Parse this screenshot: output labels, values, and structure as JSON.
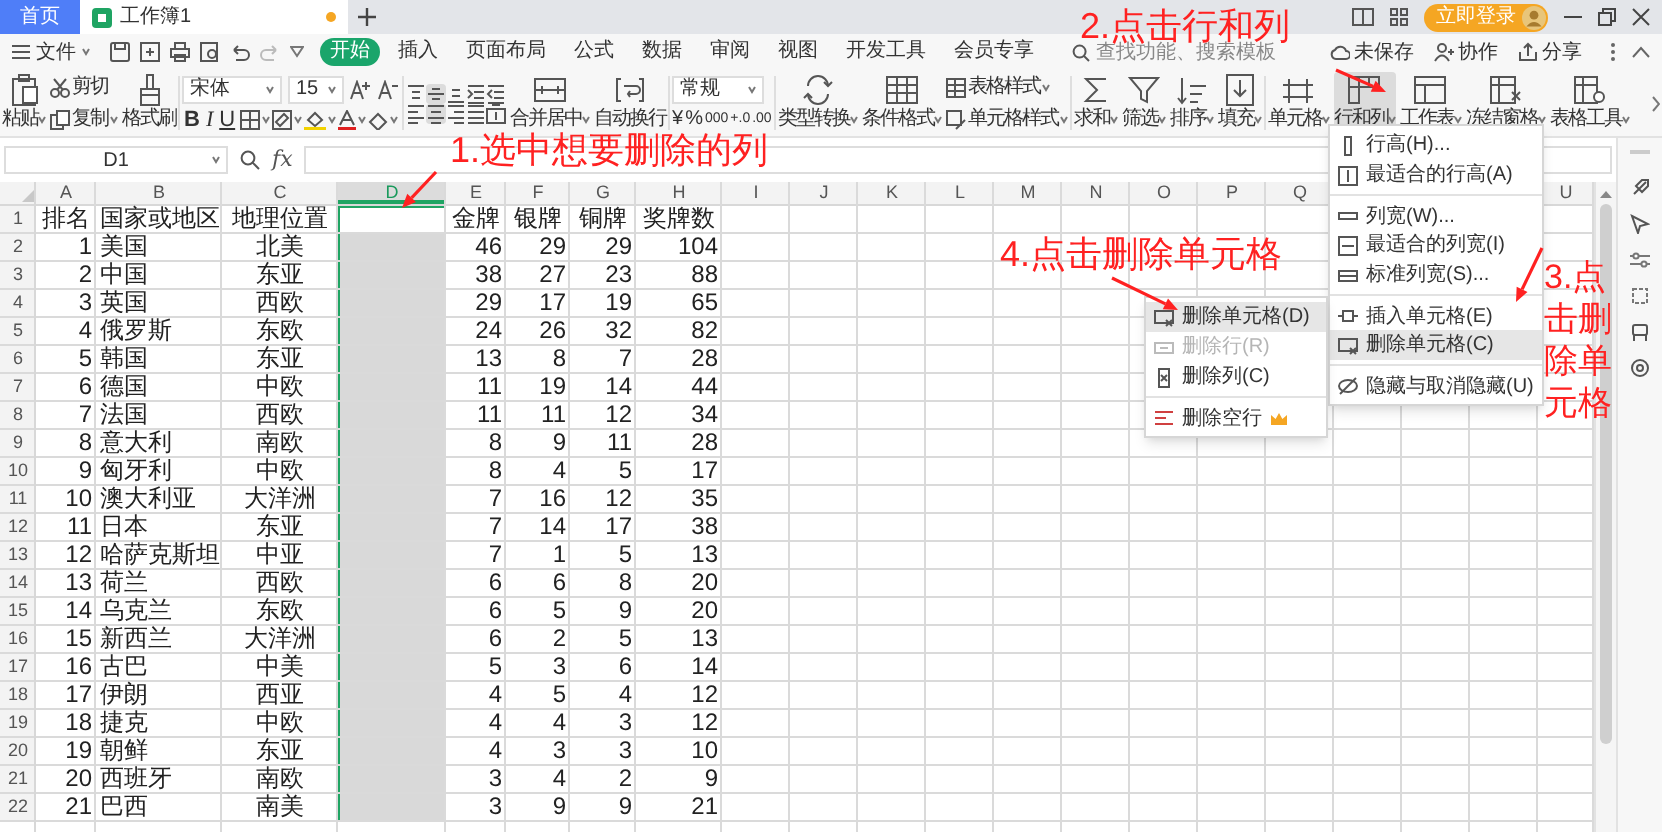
{
  "title_bar": {
    "tabs": [
      {
        "label": "首页",
        "kind": "home",
        "selected": false,
        "unsaved": false
      },
      {
        "label": "工作簿1",
        "kind": "document",
        "selected": true,
        "unsaved": true
      }
    ],
    "login_button": "立即登录"
  },
  "menu_bar": {
    "file_menu": "文件",
    "tabs": [
      {
        "label": "开始",
        "selected": true
      },
      {
        "label": "插入",
        "selected": false
      },
      {
        "label": "页面布局",
        "selected": false
      },
      {
        "label": "公式",
        "selected": false
      },
      {
        "label": "数据",
        "selected": false
      },
      {
        "label": "审阅",
        "selected": false
      },
      {
        "label": "视图",
        "selected": false
      },
      {
        "label": "开发工具",
        "selected": false
      },
      {
        "label": "会员专享",
        "selected": false
      }
    ],
    "search": {
      "placeholder": "查找功能、搜索模板"
    },
    "actions": [
      "未保存",
      "协作",
      "分享"
    ]
  },
  "ribbon": {
    "groups": [
      {
        "kind": "buttons",
        "items": [
          {
            "label": "粘贴",
            "kind": "large",
            "menu": true,
            "selected": false
          },
          {
            "label": "剪切",
            "kind": "small",
            "menu": false,
            "selected": false
          },
          {
            "label": "复制",
            "kind": "small",
            "menu": true,
            "selected": false
          },
          {
            "label": "格式刷",
            "kind": "large",
            "menu": false,
            "selected": false
          }
        ]
      },
      {
        "kind": "font",
        "family": "宋体",
        "size": "15",
        "styles": [
          "B",
          "I",
          "U"
        ]
      },
      {
        "kind": "align",
        "align_buttons": [
          {
            "selected": false
          },
          {
            "selected": true
          },
          {
            "selected": false
          },
          {
            "selected": false
          },
          {
            "selected": false
          },
          {
            "selected": false
          },
          {
            "selected": true
          },
          {
            "selected": false
          },
          {
            "selected": false
          },
          {
            "selected": false
          }
        ],
        "items": [
          {
            "label": "合并居中",
            "kind": "large",
            "menu": true,
            "selected": false
          },
          {
            "label": "自动换行",
            "kind": "large",
            "menu": false,
            "selected": false
          }
        ]
      },
      {
        "kind": "number",
        "format": "常规",
        "symbols": [
          "¥",
          "%",
          "000",
          "+.0",
          ".00"
        ]
      },
      {
        "kind": "buttons",
        "items": [
          {
            "label": "类型转换",
            "kind": "large",
            "menu": true,
            "selected": false
          },
          {
            "label": "条件格式",
            "kind": "large",
            "menu": true,
            "selected": false
          },
          {
            "label": "表格样式",
            "kind": "small",
            "menu": true,
            "selected": false
          },
          {
            "label": "单元格样式",
            "kind": "small",
            "menu": true,
            "selected": false
          }
        ]
      },
      {
        "kind": "buttons",
        "items": [
          {
            "label": "求和",
            "kind": "large",
            "menu": true,
            "selected": false
          },
          {
            "label": "筛选",
            "kind": "large",
            "menu": true,
            "selected": false
          },
          {
            "label": "排序",
            "kind": "large",
            "menu": true,
            "selected": false
          },
          {
            "label": "填充",
            "kind": "large",
            "menu": true,
            "selected": false
          }
        ]
      },
      {
        "kind": "buttons",
        "items": [
          {
            "label": "单元格",
            "kind": "large",
            "menu": true,
            "selected": false
          },
          {
            "label": "行和列",
            "kind": "large",
            "menu": true,
            "selected": true
          },
          {
            "label": "工作表",
            "kind": "large",
            "menu": true,
            "selected": false
          },
          {
            "label": "冻结窗格",
            "kind": "large",
            "menu": true,
            "selected": false
          },
          {
            "label": "表格工具",
            "kind": "large",
            "menu": true,
            "selected": false
          }
        ]
      }
    ]
  },
  "formula_bar": {
    "cell": "D1",
    "fx": "fx"
  },
  "sheet": {
    "columns": [
      {
        "label": "A",
        "selected": false
      },
      {
        "label": "B",
        "selected": false
      },
      {
        "label": "C",
        "selected": false
      },
      {
        "label": "D",
        "selected": true
      },
      {
        "label": "E",
        "selected": false
      },
      {
        "label": "F",
        "selected": false
      },
      {
        "label": "G",
        "selected": false
      },
      {
        "label": "H",
        "selected": false
      },
      {
        "label": "I",
        "selected": false
      },
      {
        "label": "J",
        "selected": false
      },
      {
        "label": "K",
        "selected": false
      },
      {
        "label": "L",
        "selected": false
      },
      {
        "label": "M",
        "selected": false
      },
      {
        "label": "N",
        "selected": false
      },
      {
        "label": "O",
        "selected": false
      },
      {
        "label": "P",
        "selected": false
      },
      {
        "label": "Q",
        "selected": false
      },
      {
        "label": "U",
        "selected": false
      }
    ],
    "rows": [
      {
        "number": "1",
        "cells": [
          "排名",
          "国家或地区",
          "地理位置",
          "金牌",
          "银牌",
          "铜牌",
          "奖牌数"
        ]
      },
      {
        "number": "2",
        "cells": [
          "1",
          "美国",
          "北美",
          "46",
          "29",
          "29",
          "104"
        ]
      },
      {
        "number": "3",
        "cells": [
          "2",
          "中国",
          "东亚",
          "38",
          "27",
          "23",
          "88"
        ]
      },
      {
        "number": "4",
        "cells": [
          "3",
          "英国",
          "西欧",
          "29",
          "17",
          "19",
          "65"
        ]
      },
      {
        "number": "5",
        "cells": [
          "4",
          "俄罗斯",
          "东欧",
          "24",
          "26",
          "32",
          "82"
        ]
      },
      {
        "number": "6",
        "cells": [
          "5",
          "韩国",
          "东亚",
          "13",
          "8",
          "7",
          "28"
        ]
      },
      {
        "number": "7",
        "cells": [
          "6",
          "德国",
          "中欧",
          "11",
          "19",
          "14",
          "44"
        ]
      },
      {
        "number": "8",
        "cells": [
          "7",
          "法国",
          "西欧",
          "11",
          "11",
          "12",
          "34"
        ]
      },
      {
        "number": "9",
        "cells": [
          "8",
          "意大利",
          "南欧",
          "8",
          "9",
          "11",
          "28"
        ]
      },
      {
        "number": "10",
        "cells": [
          "9",
          "匈牙利",
          "中欧",
          "8",
          "4",
          "5",
          "17"
        ]
      },
      {
        "number": "11",
        "cells": [
          "10",
          "澳大利亚",
          "大洋洲",
          "7",
          "16",
          "12",
          "35"
        ]
      },
      {
        "number": "12",
        "cells": [
          "11",
          "日本",
          "东亚",
          "7",
          "14",
          "17",
          "38"
        ]
      },
      {
        "number": "13",
        "cells": [
          "12",
          "哈萨克斯坦",
          "中亚",
          "7",
          "1",
          "5",
          "13"
        ]
      },
      {
        "number": "14",
        "cells": [
          "13",
          "荷兰",
          "西欧",
          "6",
          "6",
          "8",
          "20"
        ]
      },
      {
        "number": "15",
        "cells": [
          "14",
          "乌克兰",
          "东欧",
          "6",
          "5",
          "9",
          "20"
        ]
      },
      {
        "number": "16",
        "cells": [
          "15",
          "新西兰",
          "大洋洲",
          "6",
          "2",
          "5",
          "13"
        ]
      },
      {
        "number": "17",
        "cells": [
          "16",
          "古巴",
          "中美",
          "5",
          "3",
          "6",
          "14"
        ]
      },
      {
        "number": "18",
        "cells": [
          "17",
          "伊朗",
          "西亚",
          "4",
          "5",
          "4",
          "12"
        ]
      },
      {
        "number": "19",
        "cells": [
          "18",
          "捷克",
          "中欧",
          "4",
          "4",
          "3",
          "12"
        ]
      },
      {
        "number": "20",
        "cells": [
          "19",
          "朝鲜",
          "东亚",
          "4",
          "3",
          "3",
          "10"
        ]
      },
      {
        "number": "21",
        "cells": [
          "20",
          "西班牙",
          "南欧",
          "3",
          "4",
          "2",
          "9"
        ]
      },
      {
        "number": "22",
        "cells": [
          "21",
          "巴西",
          "南美",
          "3",
          "9",
          "9",
          "21"
        ]
      }
    ]
  },
  "row_col_menu": {
    "items": [
      {
        "label": "行高(H)...",
        "selected": false,
        "divider_before": false
      },
      {
        "label": "最适合的行高(A)",
        "selected": false,
        "divider_before": false
      },
      {
        "label": "列宽(W)...",
        "selected": false,
        "divider_before": true
      },
      {
        "label": "最适合的列宽(I)",
        "selected": false,
        "divider_before": false
      },
      {
        "label": "标准列宽(S)...",
        "selected": false,
        "divider_before": false
      },
      {
        "label": "插入单元格(E)",
        "selected": false,
        "divider_before": true
      },
      {
        "label": "删除单元格(C)",
        "selected": true,
        "divider_before": false
      },
      {
        "label": "隐藏与取消隐藏(U)",
        "selected": false,
        "divider_before": true
      }
    ]
  },
  "delete_submenu": {
    "items": [
      {
        "label": "删除单元格(D)",
        "selected": true,
        "disabled": false,
        "divider_before": false,
        "premium": false
      },
      {
        "label": "删除行(R)",
        "selected": false,
        "disabled": true,
        "divider_before": false,
        "premium": false
      },
      {
        "label": "删除列(C)",
        "selected": false,
        "disabled": false,
        "divider_before": false,
        "premium": false
      },
      {
        "label": "删除空行",
        "selected": false,
        "disabled": false,
        "divider_before": true,
        "premium": true
      }
    ]
  },
  "annotations": [
    {
      "text": "1.选中想要删除的列"
    },
    {
      "text": "2.点击行和列"
    },
    {
      "text": "3.点击删除单元格"
    },
    {
      "text": "4.点击删除单元格"
    }
  ]
}
